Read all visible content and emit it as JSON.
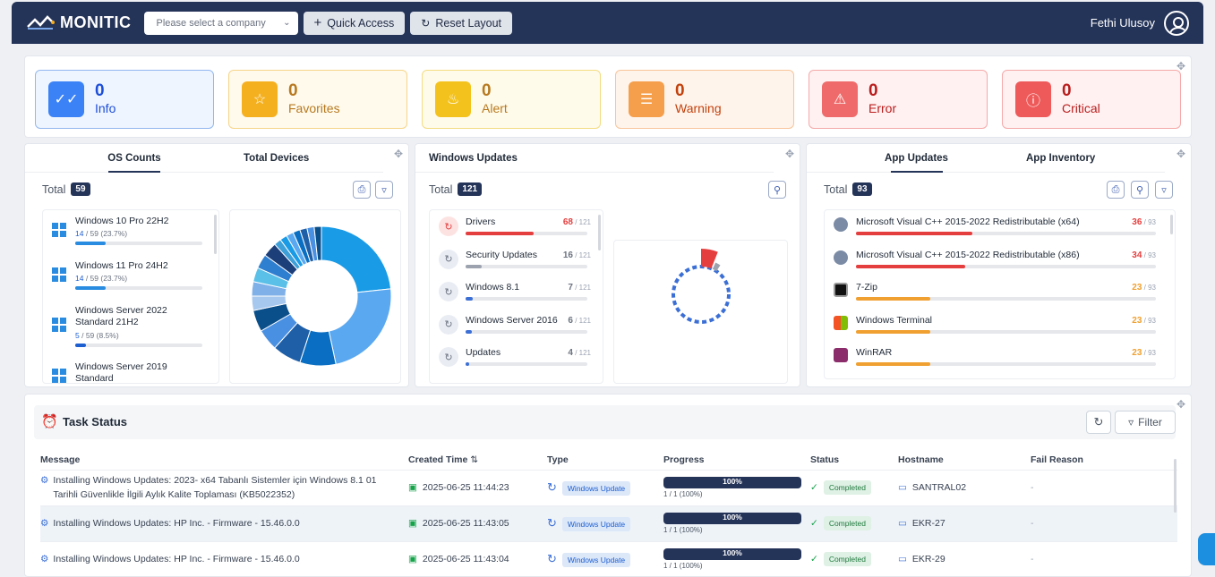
{
  "app": {
    "name": "MONITIC"
  },
  "topbar": {
    "company_placeholder": "Please select a company",
    "quick_access": "Quick Access",
    "reset_layout": "Reset Layout",
    "user_name": "Fethi Ulusoy"
  },
  "cards": [
    {
      "value": "0",
      "label": "Info",
      "color": "#3b82f6",
      "bg": "#eef5ff",
      "border": "#93b8f0",
      "text": "#1d4ed8"
    },
    {
      "value": "0",
      "label": "Favorites",
      "color": "#f5b020",
      "bg": "#fffaec",
      "border": "#f6d58a",
      "text": "#b7791f"
    },
    {
      "value": "0",
      "label": "Alert",
      "color": "#f4c21c",
      "bg": "#fffbea",
      "border": "#f3dc82",
      "text": "#b7791f"
    },
    {
      "value": "0",
      "label": "Warning",
      "color": "#f59e4b",
      "bg": "#fff4ec",
      "border": "#f8c59a",
      "text": "#c2410c"
    },
    {
      "value": "0",
      "label": "Error",
      "color": "#ef6b6b",
      "bg": "#fff1f1",
      "border": "#f5a9a9",
      "text": "#b91c1c"
    },
    {
      "value": "0",
      "label": "Critical",
      "color": "#ee5a5a",
      "bg": "#fff1f1",
      "border": "#f5a9a9",
      "text": "#b91c1c"
    }
  ],
  "os_panel": {
    "tabs": [
      "OS Counts",
      "Total Devices"
    ],
    "total_label": "Total",
    "total": "59",
    "items": [
      {
        "name": "Windows 10 Pro 22H2",
        "count": "14",
        "rest": " / 59 (23.7%)",
        "pct": 23.7
      },
      {
        "name": "Windows 11 Pro 24H2",
        "count": "14",
        "rest": " / 59 (23.7%)",
        "pct": 23.7
      },
      {
        "name": "Windows Server 2022 Standard 21H2",
        "count": "5",
        "rest": " / 59 (8.5%)",
        "pct": 8.5
      },
      {
        "name": "Windows Server 2019 Standard",
        "count": "",
        "rest": "",
        "pct": 0
      }
    ]
  },
  "updates_panel": {
    "title": "Windows Updates",
    "total_label": "Total",
    "total": "121",
    "items": [
      {
        "name": "Drivers",
        "count": "68",
        "of": " / 121",
        "value": 68,
        "color": "#e53e3e"
      },
      {
        "name": "Security Updates",
        "count": "16",
        "of": " / 121",
        "value": 16,
        "color": "#9ca3af"
      },
      {
        "name": "Windows 8.1",
        "count": "7",
        "of": " / 121",
        "value": 7,
        "color": "#3b6fd6"
      },
      {
        "name": "Windows Server 2016",
        "count": "6",
        "of": " / 121",
        "value": 6,
        "color": "#3b6fd6"
      },
      {
        "name": "Updates",
        "count": "4",
        "of": " / 121",
        "value": 4,
        "color": "#3b6fd6"
      }
    ]
  },
  "apps_panel": {
    "tabs": [
      "App Updates",
      "App Inventory"
    ],
    "total_label": "Total",
    "total": "93",
    "items": [
      {
        "name": "Microsoft Visual C++ 2015-2022 Redistributable (x64)",
        "count": "36",
        "of": " / 93",
        "value": 36,
        "color": "#e53e3e",
        "icon": "vcpp-icon"
      },
      {
        "name": "Microsoft Visual C++ 2015-2022 Redistributable (x86)",
        "count": "34",
        "of": " / 93",
        "value": 34,
        "color": "#e53e3e",
        "icon": "vcpp-icon"
      },
      {
        "name": "7-Zip",
        "count": "23",
        "of": " / 93",
        "value": 23,
        "color": "#f0a030",
        "icon": "7zip-icon"
      },
      {
        "name": "Windows Terminal",
        "count": "23",
        "of": " / 93",
        "value": 23,
        "color": "#f0a030",
        "icon": "terminal-icon"
      },
      {
        "name": "WinRAR",
        "count": "23",
        "of": " / 93",
        "value": 23,
        "color": "#f0a030",
        "icon": "winrar-icon"
      }
    ]
  },
  "tasks": {
    "title": "Task Status",
    "filter": "Filter",
    "columns": [
      "Message",
      "Created Time",
      "Type",
      "Progress",
      "Status",
      "Hostname",
      "Fail Reason"
    ],
    "rows": [
      {
        "message": "Installing Windows Updates: 2023- x64 Tabanlı Sistemler için Windows 8.1 01 Tarihli Güvenlikle İlgili Aylık Kalite Toplaması (KB5022352)",
        "time": "2025-06-25 11:44:23",
        "type": "Windows Update",
        "progress": "100%",
        "progress_sub": "1 / 1 (100%)",
        "status": "Completed",
        "host": "SANTRAL02",
        "fail": "-"
      },
      {
        "message": "Installing Windows Updates: HP Inc. - Firmware - 15.46.0.0",
        "time": "2025-06-25 11:43:05",
        "type": "Windows Update",
        "progress": "100%",
        "progress_sub": "1 / 1 (100%)",
        "status": "Completed",
        "host": "EKR-27",
        "fail": "-"
      },
      {
        "message": "Installing Windows Updates: HP Inc. - Firmware - 15.46.0.0",
        "time": "2025-06-25 11:43:04",
        "type": "Windows Update",
        "progress": "100%",
        "progress_sub": "1 / 1 (100%)",
        "status": "Completed",
        "host": "EKR-29",
        "fail": "-"
      }
    ]
  },
  "donut_colors": [
    "#1a9be6",
    "#5aa8f0",
    "#0a6fc2",
    "#1e5fa8",
    "#4a90e2",
    "#0b4f8a",
    "#a7c8ee",
    "#7fb0e8",
    "#5bc0e8",
    "#2f7fd0",
    "#1c3f7a",
    "#3ea0d8"
  ]
}
